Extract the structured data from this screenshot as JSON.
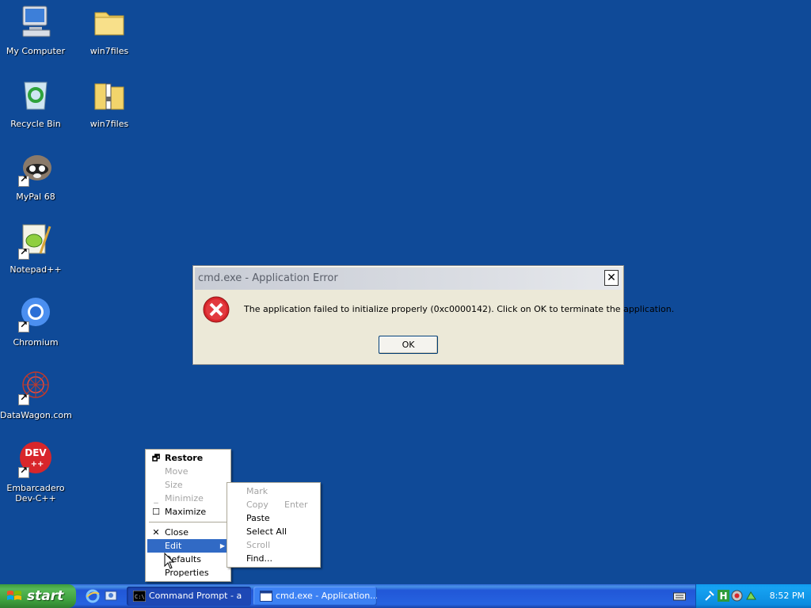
{
  "desktop": {
    "icons": [
      {
        "label": "My Computer",
        "icon": "my-computer-icon"
      },
      {
        "label": "win7files",
        "icon": "folder-icon"
      },
      {
        "label": "Recycle Bin",
        "icon": "recycle-bin-icon"
      },
      {
        "label": "win7files",
        "icon": "zip-folder-icon"
      },
      {
        "label": "MyPal 68",
        "icon": "mypal-icon"
      },
      {
        "label": "Notepad++",
        "icon": "notepad-plus-plus-icon"
      },
      {
        "label": "Chromium",
        "icon": "chromium-icon"
      },
      {
        "label": "DataWagon.com",
        "icon": "datawagon-icon"
      },
      {
        "label": "Embarcadero Dev-C++",
        "icon": "devcpp-icon"
      }
    ]
  },
  "dialog": {
    "title": "cmd.exe - Application Error",
    "message": "The application failed to initialize properly (0xc0000142). Click on OK to terminate the application.",
    "ok_label": "OK",
    "close_glyph": "✕"
  },
  "system_menu": {
    "items": [
      {
        "label": "Restore",
        "glyph": "🗗",
        "state": "bold"
      },
      {
        "label": "Move",
        "state": "disabled"
      },
      {
        "label": "Size",
        "state": "disabled"
      },
      {
        "label": "Minimize",
        "glyph": "_",
        "state": "disabled"
      },
      {
        "label": "Maximize",
        "glyph": "☐",
        "state": "normal"
      },
      {
        "label": "Close",
        "glyph": "✕",
        "state": "normal"
      },
      {
        "label": "Edit",
        "state": "selected"
      },
      {
        "label": "Defaults",
        "state": "normal"
      },
      {
        "label": "Properties",
        "state": "normal"
      }
    ]
  },
  "edit_submenu": {
    "items": [
      {
        "label": "Mark",
        "state": "disabled"
      },
      {
        "label": "Copy",
        "shortcut": "Enter",
        "state": "disabled"
      },
      {
        "label": "Paste",
        "state": "normal"
      },
      {
        "label": "Select All",
        "state": "normal"
      },
      {
        "label": "Scroll",
        "state": "disabled"
      },
      {
        "label": "Find...",
        "state": "normal"
      }
    ]
  },
  "taskbar": {
    "start_label": "start",
    "tasks": [
      {
        "label": "Command Prompt - a",
        "icon": "cmd-icon",
        "state": "pressed"
      },
      {
        "label": "cmd.exe - Application...",
        "icon": "window-icon",
        "state": "normal"
      }
    ],
    "clock": "8:52 PM"
  },
  "colors": {
    "desktop_bg": "#0f4a98",
    "menu_highlight": "#316ac5",
    "taskbar_blue": "#2663e0",
    "start_green": "#3d9e3d",
    "error_red": "#d8262b"
  }
}
